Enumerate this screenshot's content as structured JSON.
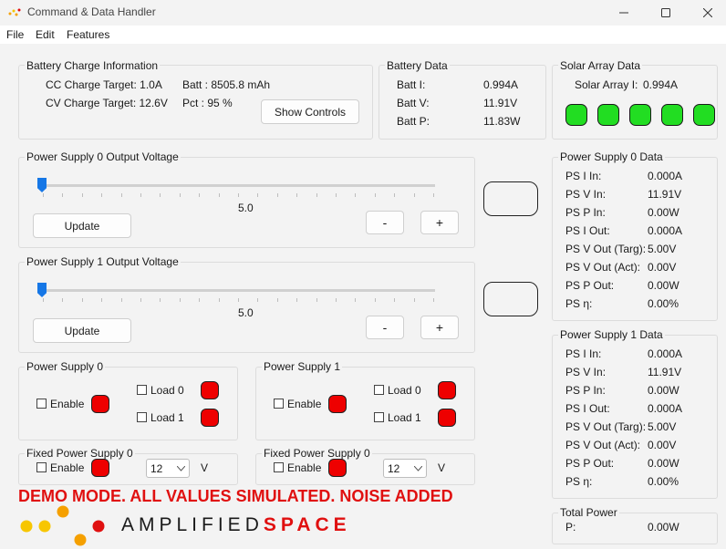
{
  "window": {
    "title": "Command & Data Handler",
    "minimize_icon": "minimize-icon",
    "maximize_icon": "maximize-icon",
    "close_icon": "close-icon"
  },
  "menu": {
    "file": "File",
    "edit": "Edit",
    "features": "Features"
  },
  "battery_charge": {
    "title": "Battery Charge Information",
    "cc_target": "CC Charge Target: 1.0A",
    "cv_target": "CV Charge Target: 12.6V",
    "batt": "Batt : 8505.8 mAh",
    "pct": "Pct : 95 %",
    "show_controls": "Show Controls"
  },
  "battery_data": {
    "title": "Battery Data",
    "rows": [
      {
        "label": "Batt I:",
        "value": "0.994A"
      },
      {
        "label": "Batt V:",
        "value": "11.91V"
      },
      {
        "label": "Batt P:",
        "value": "11.83W"
      }
    ]
  },
  "solar": {
    "title": "Solar Array Data",
    "label": "Solar Array I:",
    "value": "0.994A",
    "indicator_color": "#22dd22"
  },
  "ps0_voltage": {
    "title": "Power Supply 0 Output Voltage",
    "value": "5.0",
    "update": "Update",
    "minus": "-",
    "plus": "+"
  },
  "ps1_voltage": {
    "title": "Power Supply 1 Output Voltage",
    "value": "5.0",
    "update": "Update",
    "minus": "-",
    "plus": "+"
  },
  "ps0": {
    "title": "Power Supply 0",
    "enable": "Enable",
    "load0": "Load 0",
    "load1": "Load 1"
  },
  "ps1": {
    "title": "Power Supply 1",
    "enable": "Enable",
    "load0": "Load 0",
    "load1": "Load 1"
  },
  "fixed_a": {
    "title": "Fixed Power Supply 0",
    "enable": "Enable",
    "selected": "12",
    "unit": "V"
  },
  "fixed_b": {
    "title": "Fixed Power Supply 0",
    "enable": "Enable",
    "selected": "12",
    "unit": "V"
  },
  "ps0_data": {
    "title": "Power Supply 0 Data",
    "rows": [
      {
        "label": "PS I In:",
        "value": "0.000A"
      },
      {
        "label": "PS V In:",
        "value": "11.91V"
      },
      {
        "label": "PS P In:",
        "value": "0.00W"
      },
      {
        "label": "PS I Out:",
        "value": "0.000A"
      },
      {
        "label": "PS V Out (Targ):",
        "value": "5.00V"
      },
      {
        "label": "PS V Out (Act):",
        "value": "0.00V"
      },
      {
        "label": "PS P Out:",
        "value": "0.00W"
      },
      {
        "label": "PS η:",
        "value": "0.00%"
      }
    ]
  },
  "ps1_data": {
    "title": "Power Supply 1 Data",
    "rows": [
      {
        "label": "PS I In:",
        "value": "0.000A"
      },
      {
        "label": "PS V In:",
        "value": "11.91V"
      },
      {
        "label": "PS P In:",
        "value": "0.00W"
      },
      {
        "label": "PS I Out:",
        "value": "0.000A"
      },
      {
        "label": "PS V Out (Targ):",
        "value": "5.00V"
      },
      {
        "label": "PS V Out (Act):",
        "value": "0.00V"
      },
      {
        "label": "PS P Out:",
        "value": "0.00W"
      },
      {
        "label": "PS η:",
        "value": "0.00%"
      }
    ]
  },
  "total_power": {
    "title": "Total Power",
    "label": "P:",
    "value": "0.00W"
  },
  "demo_banner": "DEMO MODE. ALL VALUES SIMULATED. NOISE ADDED",
  "brand": {
    "amplified": "AMPLIFIED",
    "space": "SPACE",
    "red": "#e01010",
    "orange": "#f5a000",
    "yellow": "#f7c600"
  },
  "colors": {
    "led_red": "#ee0000",
    "led_green": "#22dd22",
    "slider_blue": "#1677e6"
  }
}
